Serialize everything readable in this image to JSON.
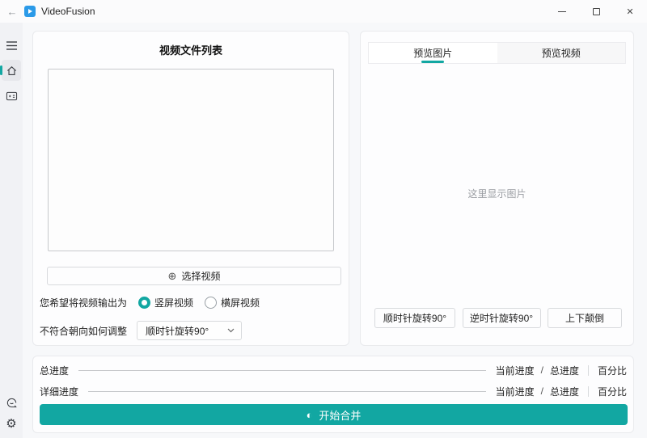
{
  "colors": {
    "accent": "#12a7a2",
    "titlebar_bg": "#fbfbfc",
    "card_bg": "#fdfdfe",
    "logo_blue": "#2b9ae8"
  },
  "titlebar": {
    "app_title": "VideoFusion"
  },
  "icons": {
    "back": "←",
    "close": "✕",
    "plus_circle": "⊕",
    "gear": "⚙",
    "start_circle": "◐"
  },
  "left_panel": {
    "title": "视频文件列表",
    "select_video_button": "选择视频",
    "output_question": "您希望将视频输出为",
    "radios": [
      {
        "label": "竖屏视频",
        "selected": true
      },
      {
        "label": "横屏视频",
        "selected": false
      }
    ],
    "orientation_question": "不符合朝向如何调整",
    "rotation_dropdown_value": "顺时针旋转90°"
  },
  "right_panel": {
    "tabs": [
      {
        "label": "预览图片",
        "active": true
      },
      {
        "label": "预览视频",
        "active": false
      }
    ],
    "preview_placeholder": "这里显示图片",
    "buttons": [
      "顺时针旋转90°",
      "逆时针旋转90°",
      "上下颠倒"
    ]
  },
  "progress_section": {
    "rows": [
      {
        "label": "总进度",
        "current_label": "当前进度",
        "slash": "/",
        "total_label": "总进度",
        "percent_label": "百分比"
      },
      {
        "label": "详细进度",
        "current_label": "当前进度",
        "slash": "/",
        "total_label": "总进度",
        "percent_label": "百分比"
      }
    ],
    "start_button": "开始合并"
  }
}
